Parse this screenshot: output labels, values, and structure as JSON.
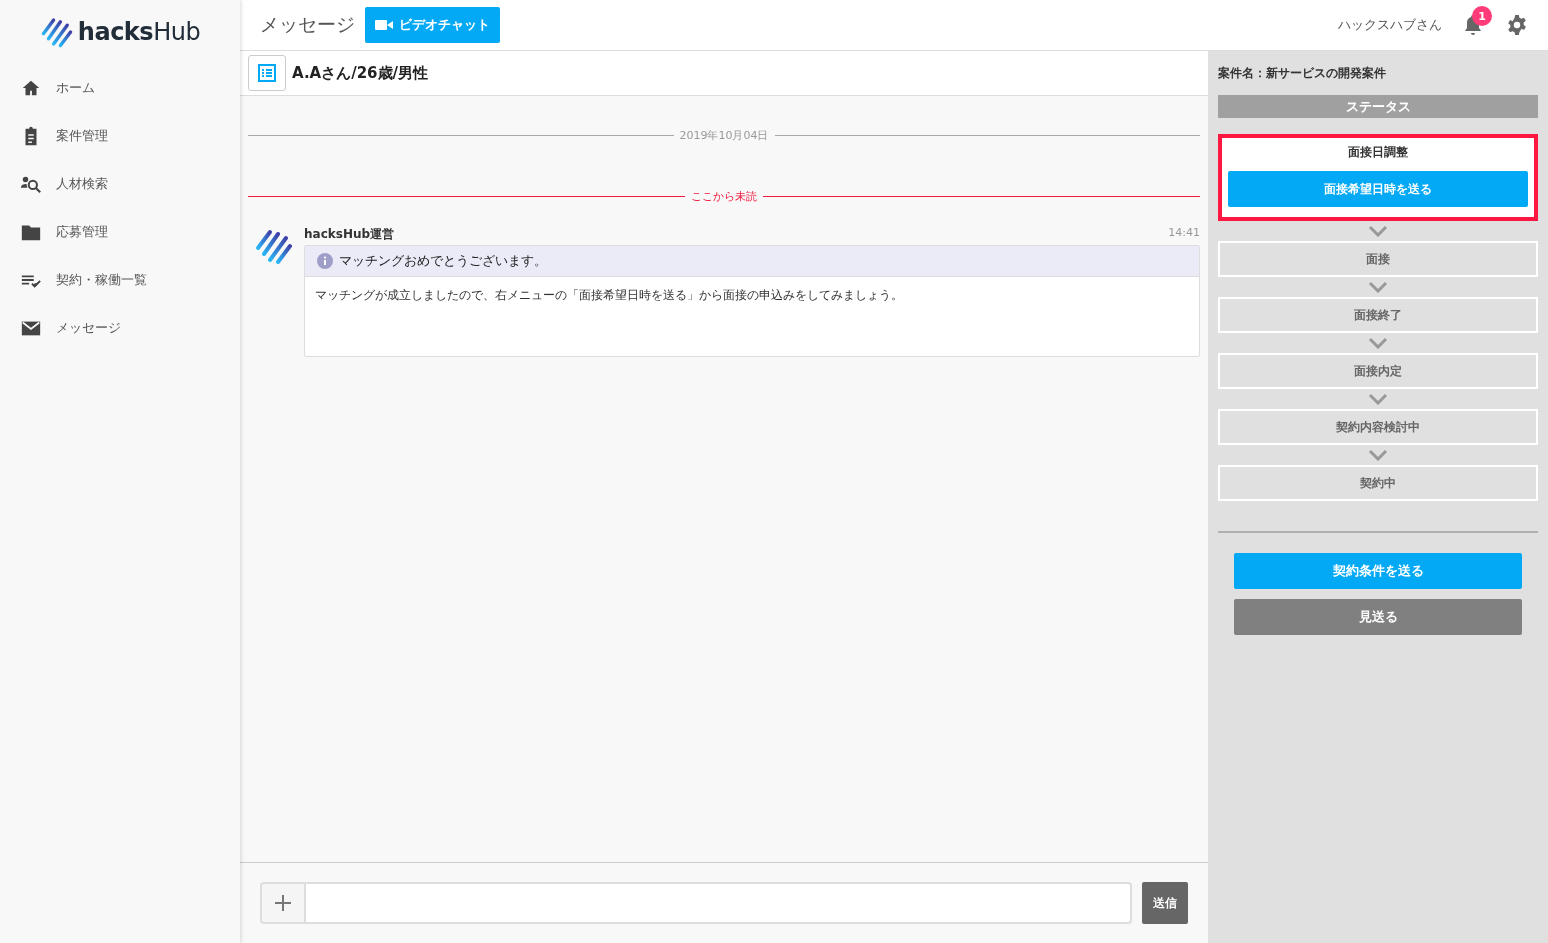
{
  "logo": {
    "text": "**hacks**Hub"
  },
  "sidebar": {
    "items": [
      {
        "label": "ホーム",
        "selected": false
      },
      {
        "label": "案件管理",
        "selected": false
      },
      {
        "label": "人材検索",
        "selected": false
      },
      {
        "label": "応募管理",
        "selected": false
      },
      {
        "label": "契約・稼働一覧",
        "selected": false
      },
      {
        "label": "メッセージ",
        "selected": false
      }
    ]
  },
  "header": {
    "title": "メッセージ",
    "video_button": "ビデオチャット",
    "user": "ハックスハブさん",
    "notification_count": "1"
  },
  "chat": {
    "partner": "A.Aさん/26歳/男性",
    "date_separator": "2019年10月04日",
    "unread_separator": "ここから未読",
    "messages": [
      {
        "sender": "hacksHub運営",
        "time": "14:41",
        "title": "マッチングおめでとうございます。",
        "body": "マッチングが成立しましたので、右メニューの「面接希望日時を送る」から面接の申込みをしてみましょう。"
      }
    ]
  },
  "composer": {
    "send_button": "送信"
  },
  "status_panel": {
    "project": "案件名：新サービスの開発案件",
    "heading": "ステータス",
    "steps": [
      {
        "label": "面接日調整",
        "selected": true,
        "action": "面接希望日時を送る"
      },
      {
        "label": "面接",
        "selected": false
      },
      {
        "label": "面接終了",
        "selected": false
      },
      {
        "label": "面接内定",
        "selected": false
      },
      {
        "label": "契約内容検討中",
        "selected": false
      },
      {
        "label": "契約中",
        "selected": false
      }
    ],
    "buttons": [
      {
        "label": "契約条件を送る",
        "kind": "primary"
      },
      {
        "label": "見送る",
        "kind": "secondary"
      }
    ]
  }
}
